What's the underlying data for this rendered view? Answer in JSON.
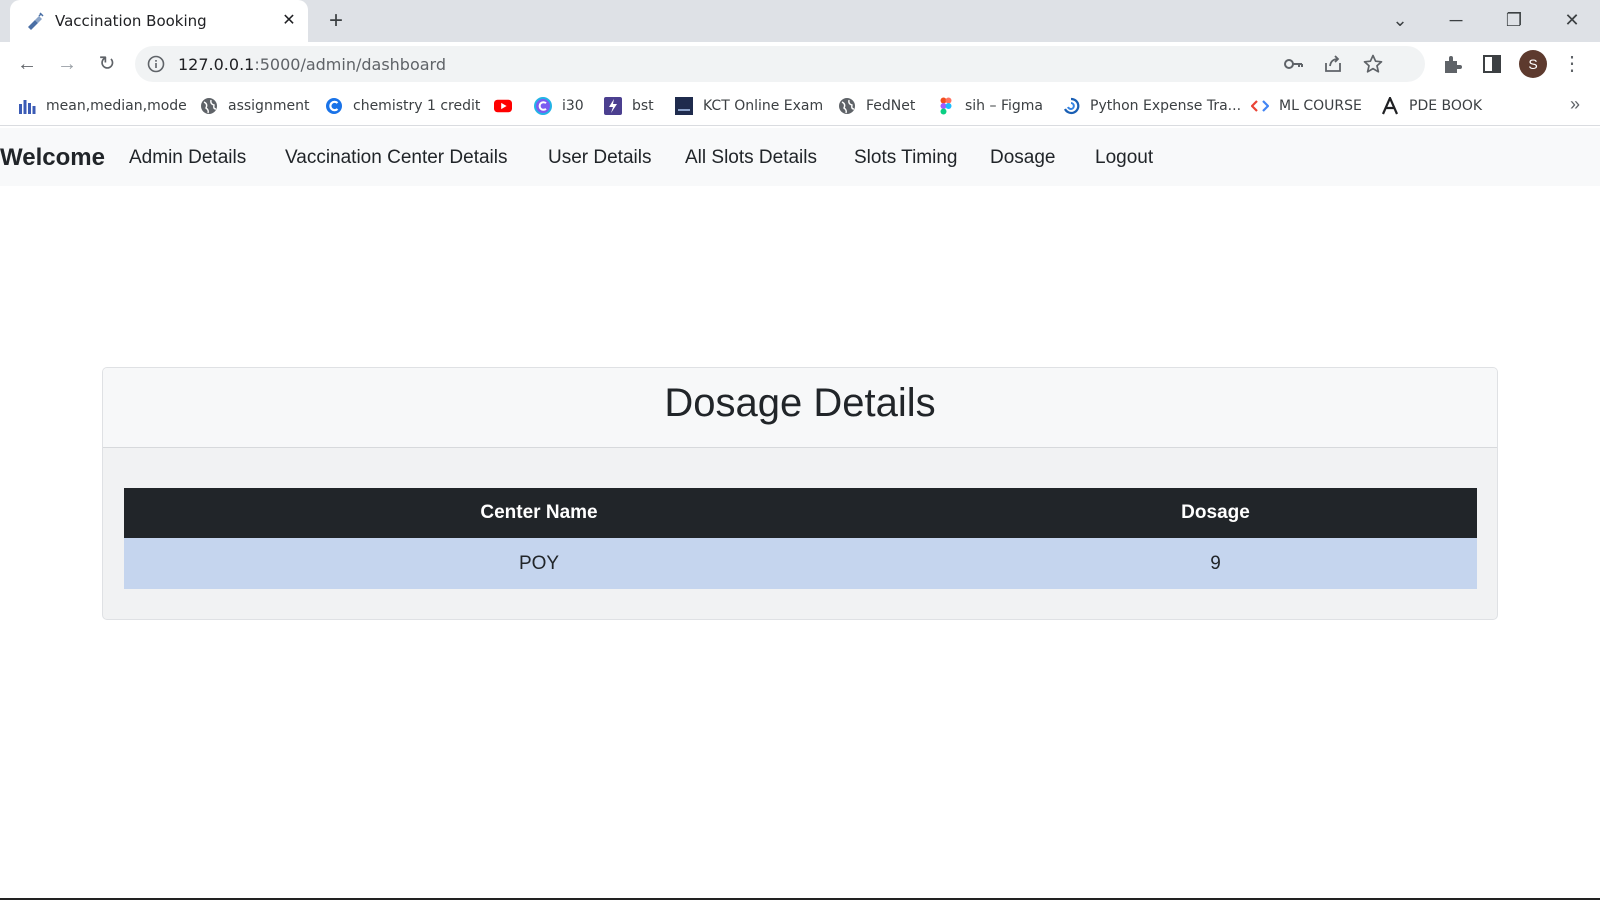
{
  "browser": {
    "tab_title": "Vaccination Booking",
    "tab_close": "✕",
    "new_tab": "+",
    "url_host": "127.0.0.1",
    "url_path": ":5000/admin/dashboard",
    "avatar_initial": "S",
    "bookmarks": [
      {
        "label": "mean,median,mode",
        "icon": "bar-chart-icon"
      },
      {
        "label": "assignment",
        "icon": "globe-icon"
      },
      {
        "label": "chemistry 1 credit",
        "icon": "c-logo-icon"
      },
      {
        "label": "",
        "icon": "youtube-icon"
      },
      {
        "label": "i30",
        "icon": "c-gradient-icon"
      },
      {
        "label": "bst",
        "icon": "bolt-icon"
      },
      {
        "label": "KCT Online Exam",
        "icon": "kct-icon"
      },
      {
        "label": "FedNet",
        "icon": "globe-icon"
      },
      {
        "label": "sih – Figma",
        "icon": "figma-icon"
      },
      {
        "label": "Python Expense Tra...",
        "icon": "loop-icon"
      },
      {
        "label": "ML COURSE",
        "icon": "code-icon"
      },
      {
        "label": "PDE BOOK",
        "icon": "letter-a-icon"
      }
    ],
    "bookmarks_more": "»"
  },
  "navbar": {
    "brand": "Welcome",
    "links": [
      "Admin Details",
      "Vaccination Center Details",
      "User Details",
      "All Slots Details",
      "Slots Timing",
      "Dosage",
      "Logout"
    ]
  },
  "card": {
    "title": "Dosage Details",
    "table": {
      "headers": [
        "Center Name",
        "Dosage"
      ],
      "rows": [
        [
          "POY",
          "9"
        ]
      ]
    }
  },
  "colors": {
    "table_header_bg": "#212529",
    "table_row_bg": "#c5d5ee",
    "navbar_bg": "#f8f9fa"
  }
}
